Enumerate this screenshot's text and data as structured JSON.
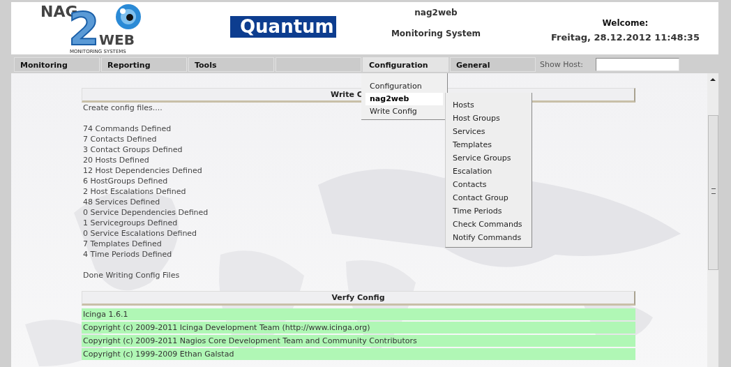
{
  "header": {
    "logo": {
      "top": "NAG",
      "digit": "2",
      "bottom": "WEB",
      "tagline": "MONITORING SYSTEMS"
    },
    "partner_logo": "Quantum",
    "app_name": "nag2web",
    "app_subtitle": "Monitoring System",
    "welcome": "Welcome:",
    "datetime": "Freitag, 28.12.2012 11:48:35"
  },
  "nav": {
    "items": [
      {
        "label": "Monitoring",
        "selected": false
      },
      {
        "label": "Reporting",
        "selected": false
      },
      {
        "label": "Tools",
        "selected": false
      },
      {
        "selected": false
      },
      {
        "label": "Configuration",
        "selected": true
      },
      {
        "label": "General",
        "selected": false
      }
    ],
    "search": {
      "label": "Show Host:"
    }
  },
  "dropdown": {
    "items": [
      {
        "label": "Configuration",
        "selected": false
      },
      {
        "label": "nag2web",
        "selected": true
      },
      {
        "label": "Write Config",
        "selected": false
      }
    ],
    "submenu": [
      "Hosts",
      "Host Groups",
      "Services",
      "Templates",
      "Service Groups",
      "Escalation",
      "Contacts",
      "Contact Group",
      "Time Periods",
      "Check Commands",
      "Notify Commands"
    ]
  },
  "write_section": {
    "title": "Write C",
    "intro": "Create config files....",
    "lines": [
      "74 Commands Defined",
      "7 Contacts Defined",
      "3 Contact Groups Defined",
      "20 Hosts Defined",
      "12 Host Dependencies Defined",
      "6 HostGroups Defined",
      "2 Host Escalations Defined",
      "48 Services Defined",
      "0 Service Dependencies Defined",
      "1 Servicegroups Defined",
      "0 Service Escalations Defined",
      "7 Templates Defined",
      "4 Time Periods Defined"
    ],
    "done": "Done Writing Config Files"
  },
  "verify_section": {
    "title": "Verfy Config",
    "lines": [
      "Icinga 1.6.1",
      "Copyright (c) 2009-2011 Icinga Development Team (http://www.icinga.org)",
      "Copyright (c) 2009-2011 Nagios Core Development Team and Community Contributors",
      "Copyright (c) 1999-2009 Ethan Galstad"
    ]
  }
}
